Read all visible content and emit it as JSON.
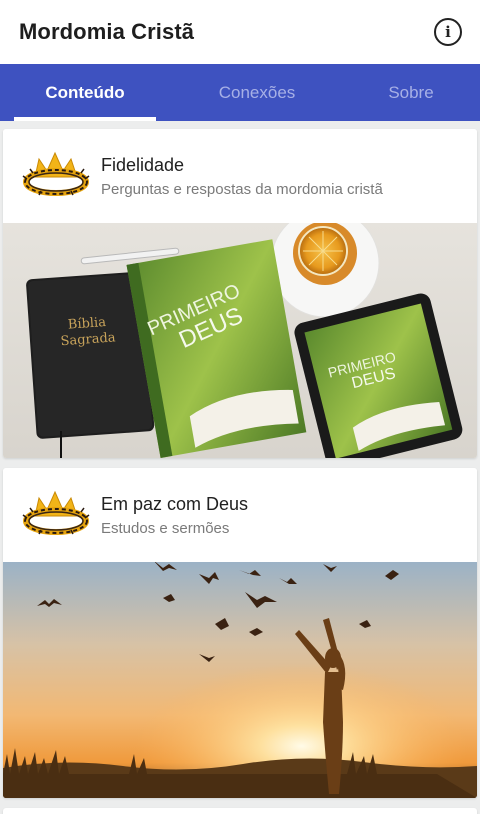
{
  "app": {
    "title": "Mordomia Cristã",
    "info_icon": "info-icon",
    "info_glyph": "i"
  },
  "tabs": [
    {
      "label": "Conteúdo",
      "active": true
    },
    {
      "label": "Conexões",
      "active": false
    },
    {
      "label": "Sobre",
      "active": false
    }
  ],
  "cards": [
    {
      "title": "Fidelidade",
      "subtitle": "Perguntas e respostas da mordomia cristã",
      "image": {
        "bible_line1": "Bíblia",
        "bible_line2": "Sagrada",
        "book_line1": "PRIMEIRO",
        "book_line2": "DEUS",
        "tablet_line1": "PRIMEIRO",
        "tablet_line2": "DEUS"
      }
    },
    {
      "title": "Em paz com Deus",
      "subtitle": "Estudos e sermões"
    }
  ],
  "colors": {
    "accent": "#3e52c0",
    "tab_inactive": "#a7b0e6",
    "background": "#eceded"
  }
}
